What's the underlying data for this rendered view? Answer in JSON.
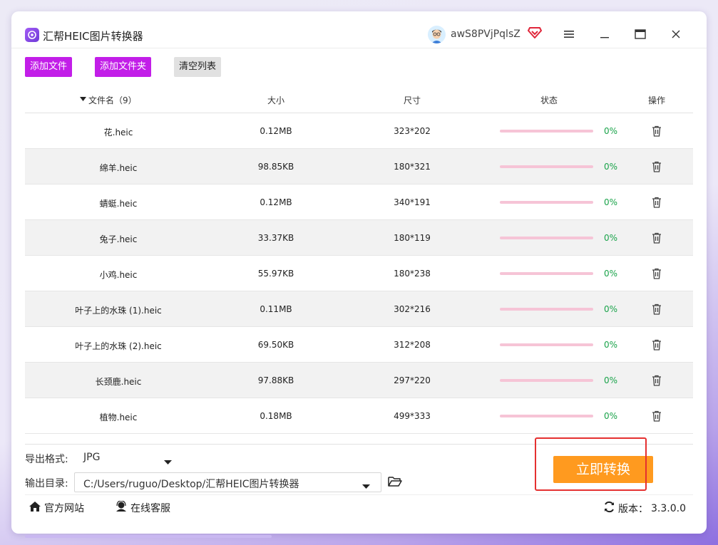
{
  "app": {
    "title": "汇帮HEIC图片转换器",
    "username": "awS8PVjPqlsZ"
  },
  "toolbar": {
    "add_files": "添加文件",
    "add_folder": "添加文件夹",
    "clear_list": "清空列表"
  },
  "table": {
    "headers": {
      "name": "文件名（9）",
      "size": "大小",
      "dimensions": "尺寸",
      "status": "状态",
      "actions": "操作"
    },
    "rows": [
      {
        "name": "花.heic",
        "size": "0.12MB",
        "dimensions": "323*202",
        "progress": 0,
        "status": "0%"
      },
      {
        "name": "绵羊.heic",
        "size": "98.85KB",
        "dimensions": "180*321",
        "progress": 0,
        "status": "0%"
      },
      {
        "name": "蜻蜓.heic",
        "size": "0.12MB",
        "dimensions": "340*191",
        "progress": 0,
        "status": "0%"
      },
      {
        "name": "兔子.heic",
        "size": "33.37KB",
        "dimensions": "180*119",
        "progress": 0,
        "status": "0%"
      },
      {
        "name": "小鸡.heic",
        "size": "55.97KB",
        "dimensions": "180*238",
        "progress": 0,
        "status": "0%"
      },
      {
        "name": "叶子上的水珠 (1).heic",
        "size": "0.11MB",
        "dimensions": "302*216",
        "progress": 0,
        "status": "0%"
      },
      {
        "name": "叶子上的水珠 (2).heic",
        "size": "69.50KB",
        "dimensions": "312*208",
        "progress": 0,
        "status": "0%"
      },
      {
        "name": "长颈鹿.heic",
        "size": "97.88KB",
        "dimensions": "297*220",
        "progress": 0,
        "status": "0%"
      },
      {
        "name": "植物.heic",
        "size": "0.18MB",
        "dimensions": "499*333",
        "progress": 0,
        "status": "0%"
      }
    ]
  },
  "output": {
    "format_label": "导出格式:",
    "format_value": "JPG",
    "dir_label": "输出目录:",
    "dir_value": "C:/Users/ruguo/Desktop/汇帮HEIC图片转换器"
  },
  "convert_button": "立即转换",
  "footer": {
    "website": "官方网站",
    "support": "在线客服",
    "version_label": "版本：",
    "version": "3.3.0.0"
  },
  "colors": {
    "accent_purple": "#c21ee8",
    "convert_orange": "#ff9a1f",
    "progress_track": "#f6c4d6",
    "percent_green": "#1aa34a",
    "highlight_red": "#e53030"
  },
  "icons": {
    "logo": "app-logo-icon",
    "vip": "vip-diamond-icon",
    "menu": "hamburger-icon",
    "minimize": "minimize-icon",
    "maximize": "maximize-icon",
    "close": "close-icon",
    "trash": "trash-icon",
    "folder": "folder-icon",
    "home": "home-icon",
    "support": "headset-icon",
    "refresh": "refresh-icon"
  }
}
